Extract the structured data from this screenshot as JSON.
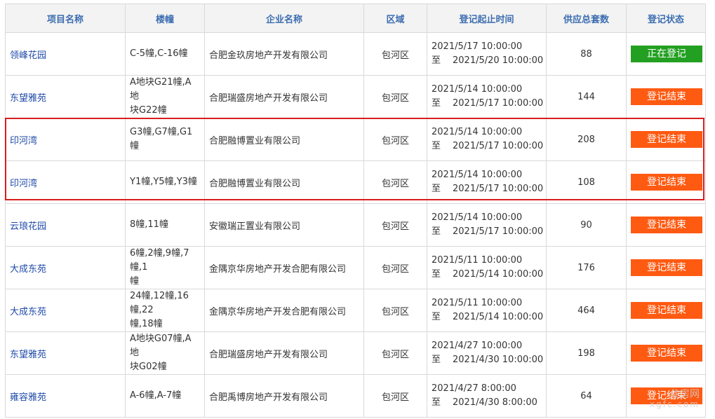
{
  "headers": [
    "项目名称",
    "楼幢",
    "企业名称",
    "区域",
    "登记起止时间",
    "供应总套数",
    "登记状态"
  ],
  "rows": [
    {
      "project": "领峰花园",
      "buildings": [
        "C-5幢,C-16幢"
      ],
      "company": "合肥金玖房地产开发有限公司",
      "district": "包河区",
      "start": "2021/5/17 10:00:00",
      "to": "至",
      "end": "2021/5/20 10:00:00",
      "units": "88",
      "status": "正在登记",
      "status_color": "#23a022"
    },
    {
      "project": "东望雅苑",
      "buildings": [
        "A地块G21幢,A地",
        "块G22幢"
      ],
      "company": "合肥瑞盛房地产开发有限公司",
      "district": "包河区",
      "start": "2021/5/14 10:00:00",
      "to": "至",
      "end": "2021/5/17 10:00:00",
      "units": "144",
      "status": "登记结束",
      "status_color": "#ff5a12"
    },
    {
      "project": "印河湾",
      "buildings": [
        "G3幢,G7幢,G1幢"
      ],
      "company": "合肥融博置业有限公司",
      "district": "包河区",
      "start": "2021/5/14 10:00:00",
      "to": "至",
      "end": "2021/5/17 10:00:00",
      "units": "208",
      "status": "登记结束",
      "status_color": "#ff5a12"
    },
    {
      "project": "印河湾",
      "buildings": [
        "Y1幢,Y5幢,Y3幢"
      ],
      "company": "合肥融博置业有限公司",
      "district": "包河区",
      "start": "2021/5/14 10:00:00",
      "to": "至",
      "end": "2021/5/17 10:00:00",
      "units": "108",
      "status": "登记结束",
      "status_color": "#ff5a12"
    },
    {
      "project": "云琅花园",
      "buildings": [
        "8幢,11幢"
      ],
      "company": "安徽瑞正置业有限公司",
      "district": "包河区",
      "start": "2021/5/14 10:00:00",
      "to": "至",
      "end": "2021/5/17 10:00:00",
      "units": "90",
      "status": "登记结束",
      "status_color": "#ff5a12"
    },
    {
      "project": "大成东苑",
      "buildings": [
        "6幢,2幢,9幢,7幢,1",
        "幢"
      ],
      "company": "金隅京华房地产开发合肥有限公司",
      "district": "包河区",
      "start": "2021/5/11 10:00:00",
      "to": "至",
      "end": "2021/5/14 10:00:00",
      "units": "176",
      "status": "登记结束",
      "status_color": "#ff5a12"
    },
    {
      "project": "大成东苑",
      "buildings": [
        "24幢,12幢,16幢,22",
        "幢,18幢"
      ],
      "company": "金隅京华房地产开发合肥有限公司",
      "district": "包河区",
      "start": "2021/5/11 10:00:00",
      "to": "至",
      "end": "2021/5/14 10:00:00",
      "units": "464",
      "status": "登记结束",
      "status_color": "#ff5a12"
    },
    {
      "project": "东望雅苑",
      "buildings": [
        "A地块G07幢,A地",
        "块G02幢"
      ],
      "company": "合肥瑞盛房地产开发有限公司",
      "district": "包河区",
      "start": "2021/4/27 10:00:00",
      "to": "至",
      "end": "2021/4/30 10:00:00",
      "units": "198",
      "status": "登记结束",
      "status_color": "#ff5a12"
    },
    {
      "project": "雍容雅苑",
      "buildings": [
        "A-6幢,A-7幢"
      ],
      "company": "合肥禹博房地产开发有限公司",
      "district": "包河区",
      "start": "2021/4/27 8:00:00",
      "to": "至",
      "end": "2021/4/30 8:00:00",
      "units": "64",
      "status": "登记结束",
      "status_color": "#ff5a12"
    }
  ],
  "watermark": {
    "line1": "住房网",
    "line2": "xgfc.com"
  }
}
